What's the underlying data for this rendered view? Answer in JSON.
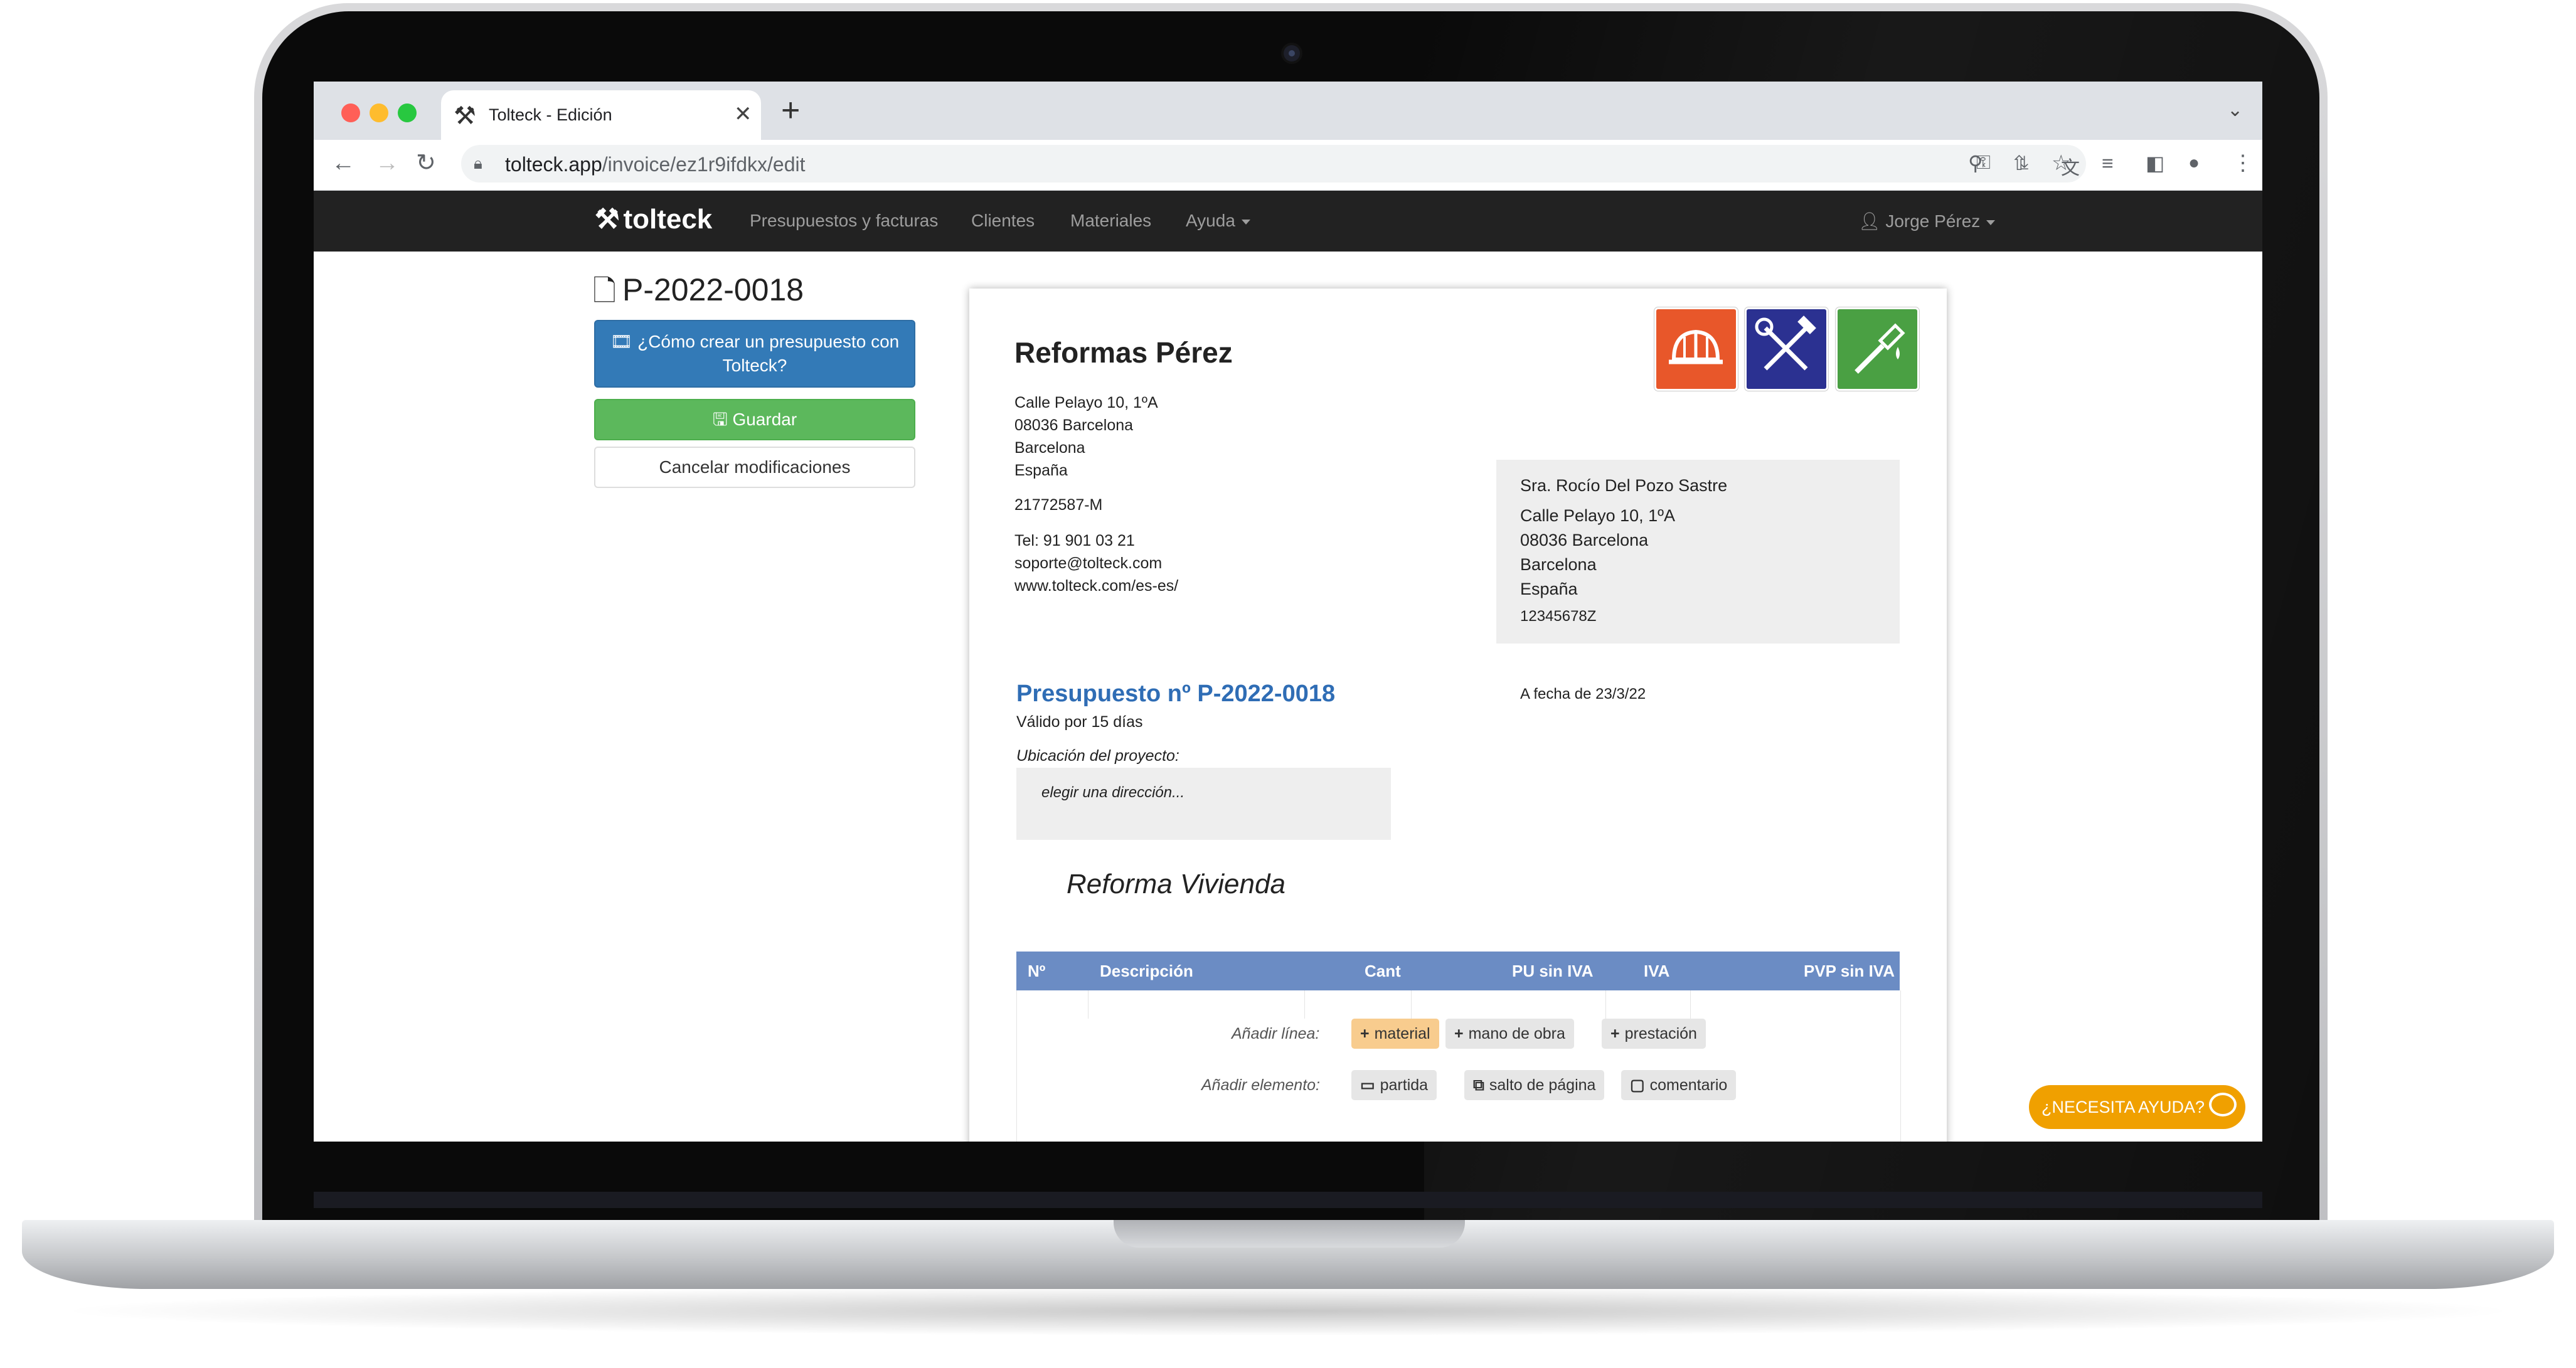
{
  "browser": {
    "tab_title": "Tolteck - Edición",
    "url_domain": "tolteck.app",
    "url_path": "/invoice/ez1r9ifdkx/edit"
  },
  "navbar": {
    "brand": "tolteck",
    "links": [
      "Presupuestos y facturas",
      "Clientes",
      "Materiales",
      "Ayuda"
    ],
    "user": "Jorge Pérez"
  },
  "sidebar": {
    "doc_number": "P-2022-0018",
    "help_button": "¿Cómo crear un presupuesto con Tolteck?",
    "save_button": "Guardar",
    "cancel_button": "Cancelar modificaciones"
  },
  "company": {
    "name": "Reformas Pérez",
    "address": [
      "Calle Pelayo 10, 1ºA",
      "08036 Barcelona",
      "Barcelona",
      "España"
    ],
    "tax_id": "21772587-M",
    "phone": "Tel: 91 901 03 21",
    "email": "soporte@tolteck.com",
    "web": "www.tolteck.com/es-es/"
  },
  "client": {
    "name": "Sra. Rocío Del Pozo Sastre",
    "address": [
      "Calle Pelayo 10, 1ºA",
      "08036 Barcelona",
      "Barcelona",
      "España"
    ],
    "tax_id": "12345678Z"
  },
  "quote": {
    "title": "Presupuesto nº P-2022-0018",
    "date": "A fecha de 23/3/22",
    "validity": "Válido por 15 días",
    "location_label": "Ubicación del proyecto:",
    "location_placeholder": "elegir una dirección...",
    "section_title": "Reforma Vivienda"
  },
  "table": {
    "headers": [
      "Nº",
      "Descripción",
      "Cant",
      "PU sin IVA",
      "IVA",
      "PVP sin IVA"
    ]
  },
  "add_line": {
    "label": "Añadir línea:",
    "options": [
      "material",
      "mano de obra",
      "prestación"
    ]
  },
  "add_element": {
    "label": "Añadir elemento:",
    "options": [
      "partida",
      "salto de página",
      "comentario"
    ]
  },
  "help_widget": "¿NECESITA AYUDA?",
  "colors": {
    "navbar": "#222222",
    "primary": "#337ab7",
    "success": "#5cb85c",
    "table_header": "#6b8cc4",
    "quote_title": "#2f6db5",
    "logo_orange": "#e8572a",
    "logo_blue": "#2b3191",
    "logo_green": "#4aa043",
    "help_widget": "#f0a000"
  }
}
